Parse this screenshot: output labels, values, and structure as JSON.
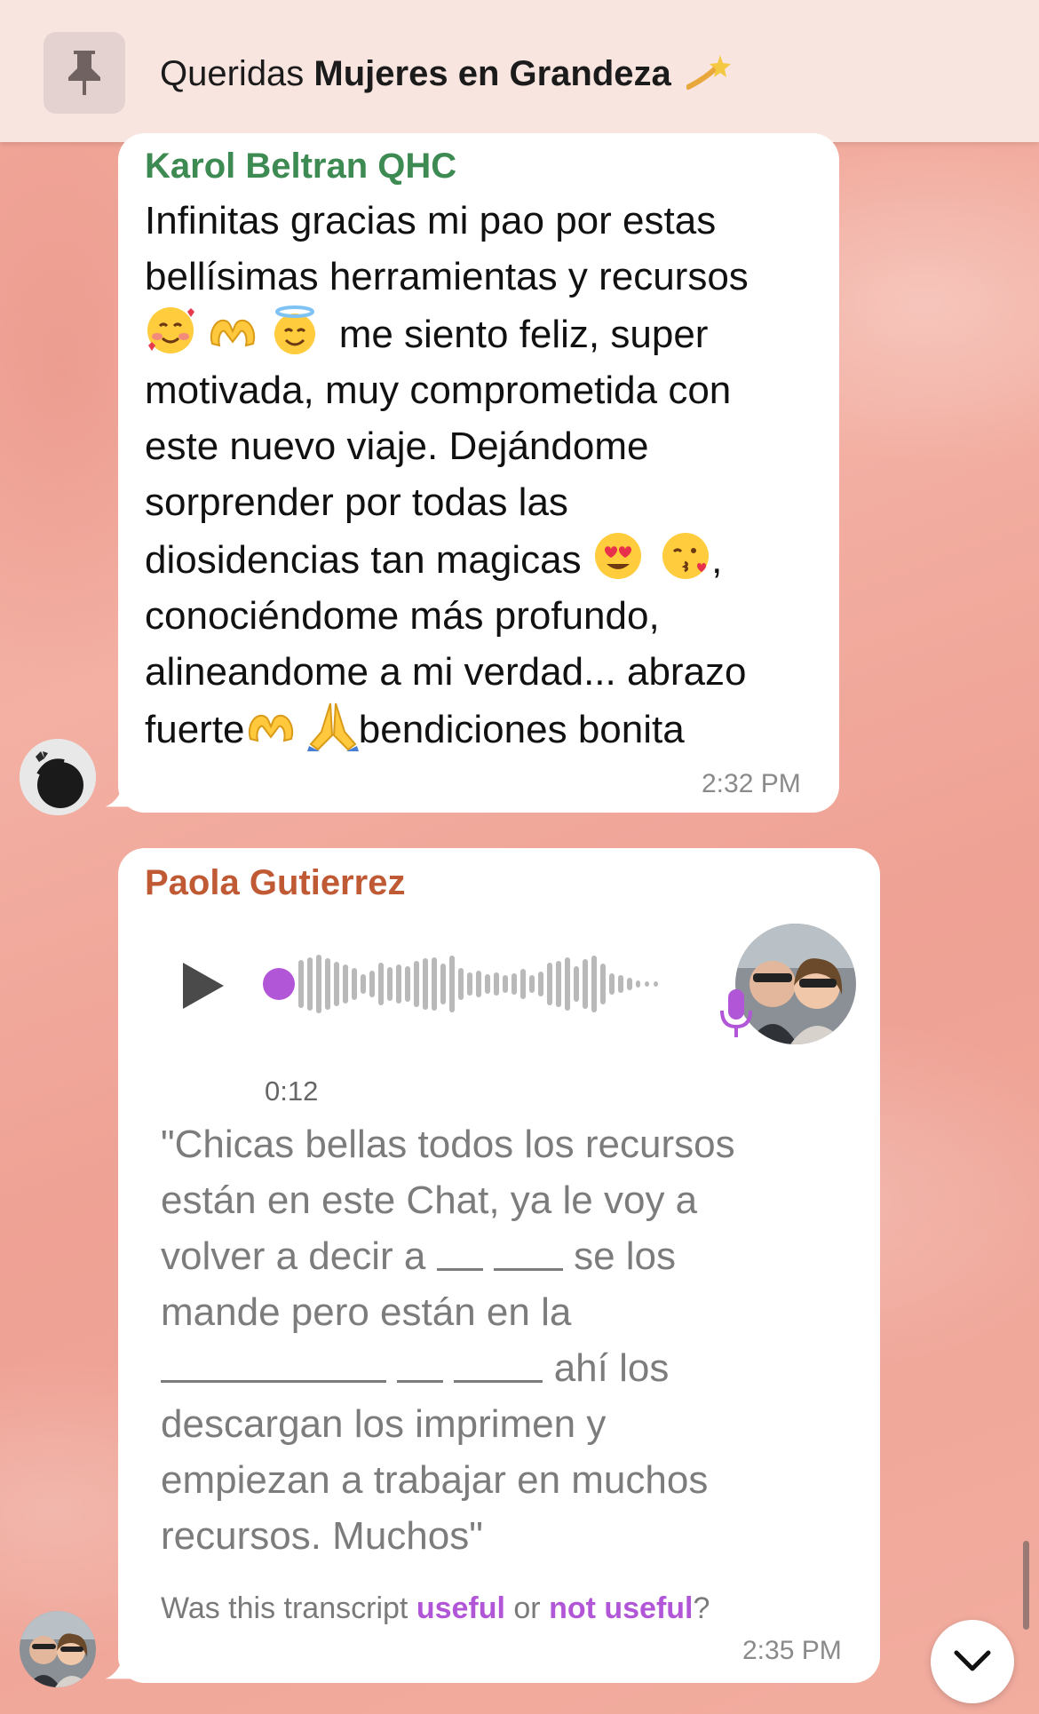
{
  "pinned": {
    "prefix": "Queridas ",
    "title": "Mujeres en Grandeza",
    "icon": "pin-icon"
  },
  "messages": [
    {
      "sender": "Karol Beltran QHC",
      "sender_color": "#3d8a53",
      "text": {
        "l1": "Infinitas gracias mi pao por estas",
        "l2": "bellísimas herramientas y recursos",
        "l3": "me siento feliz, super",
        "l4": "motivada, muy comprometida con",
        "l5": "este nuevo viaje. Dejándome",
        "l6": "sorprender por todas las",
        "l7": "diosidencias tan magicas",
        "l7b": ",",
        "l8": "conociéndome más profundo,",
        "l9": "alineandome a mi verdad... abrazo",
        "l10a": "fuerte",
        "l10b": "bendiciones bonita"
      },
      "time": "2:32 PM"
    },
    {
      "sender": "Paola Gutierrez",
      "sender_color": "#c05a35",
      "voice": {
        "duration": "0:12",
        "progress": 0,
        "accent": "#b256d8"
      },
      "transcript": {
        "t1": "\"Chicas bellas todos los recursos",
        "t2": "están en este Chat, ya le voy a",
        "t3a": "volver a decir a",
        "t3b": "se los",
        "t4": "mande pero están en la",
        "t5b": "ahí los",
        "t6": "descargan los imprimen y",
        "t7": "empiezan a trabajar en muchos",
        "t8": "recursos. Muchos\""
      },
      "feedback": {
        "prefix": "Was this transcript ",
        "useful": "useful",
        "middle": " or ",
        "not_useful": "not useful",
        "suffix": "?"
      },
      "time": "2:35 PM"
    }
  ],
  "icons": [
    "pin-icon",
    "sparkle-emoji",
    "play-icon",
    "microphone-icon",
    "chevron-down-icon"
  ]
}
